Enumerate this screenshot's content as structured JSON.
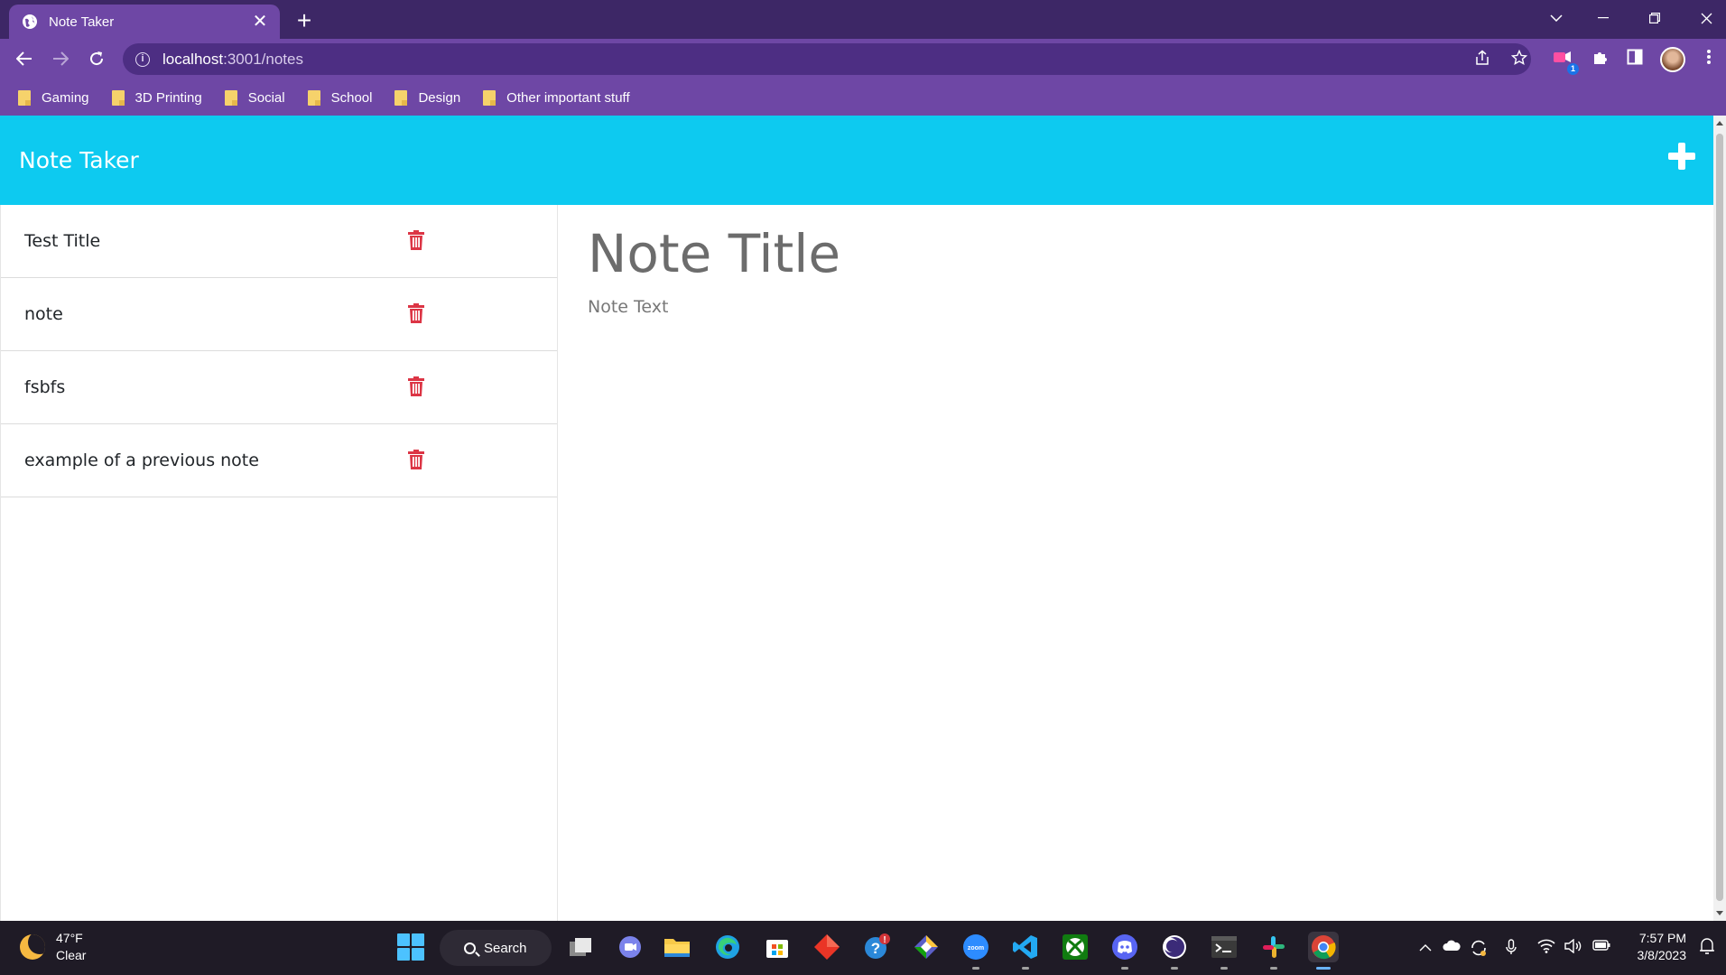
{
  "browser": {
    "tab_title": "Note Taker",
    "tab_close": "✕",
    "new_tab": "+",
    "url_host": "localhost",
    "url_path": ":3001/notes",
    "bookmarks": [
      "Gaming",
      "3D Printing",
      "Social",
      "School",
      "Design",
      "Other important stuff"
    ],
    "extension_badge": "1"
  },
  "app": {
    "brand": "Note Taker",
    "notes": [
      {
        "title": "Test Title"
      },
      {
        "title": "note"
      },
      {
        "title": "fsbfs"
      },
      {
        "title": "example of a previous note"
      }
    ],
    "editor": {
      "title_placeholder": "Note Title",
      "text_placeholder": "Note Text"
    },
    "colors": {
      "navbar": "#0dcaf0",
      "delete_icon": "#dc3545"
    }
  },
  "taskbar": {
    "temperature": "47°F",
    "condition": "Clear",
    "search_label": "Search",
    "time": "7:57 PM",
    "date": "3/8/2023"
  }
}
